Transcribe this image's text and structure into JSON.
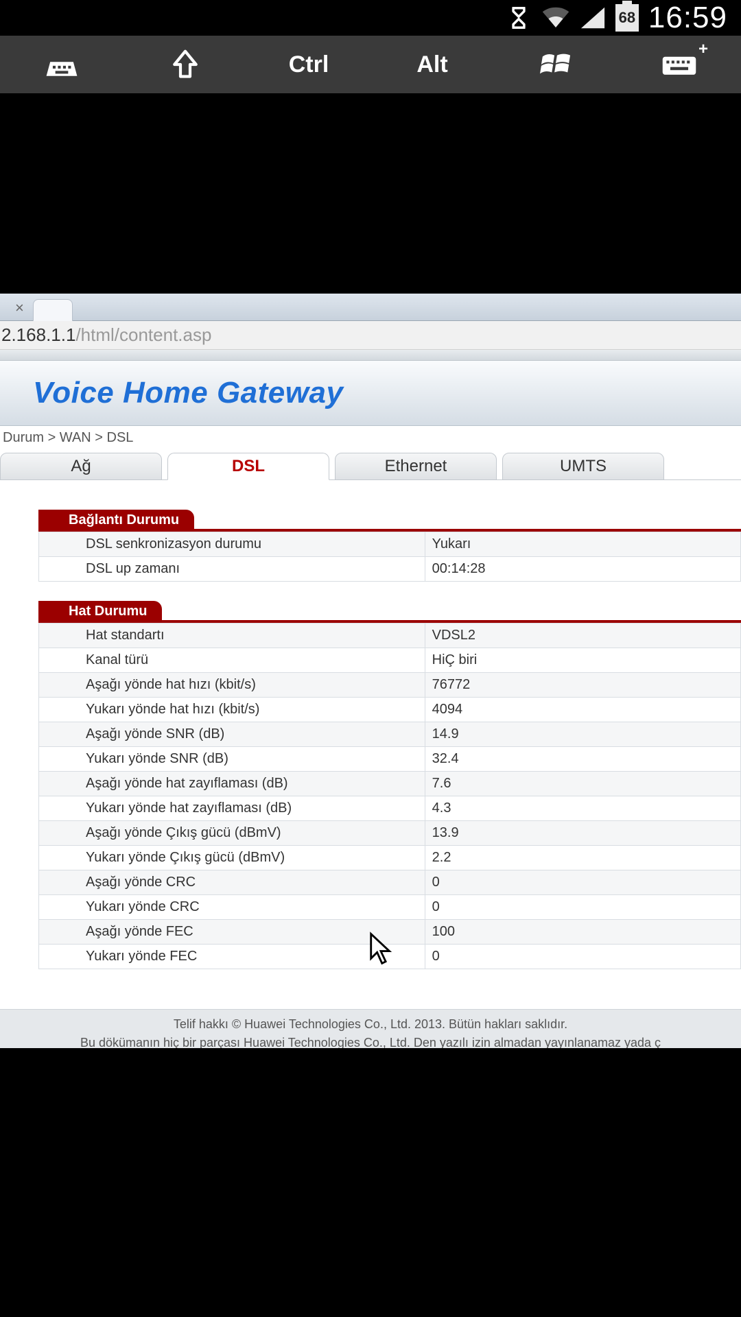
{
  "status_bar": {
    "battery_level": "68",
    "clock": "16:59"
  },
  "rdp_toolbar": {
    "ctrl": "Ctrl",
    "alt": "Alt"
  },
  "browser": {
    "url_host": "2.168.1.1",
    "url_path": "/html/content.asp"
  },
  "page": {
    "title": "Voice Home Gateway",
    "breadcrumb": "Durum > WAN > DSL",
    "tabs": {
      "ag": "Ağ",
      "dsl": "DSL",
      "ethernet": "Ethernet",
      "umts": "UMTS"
    },
    "section1": {
      "title": "Bağlantı Durumu",
      "rows": [
        {
          "label": "DSL senkronizasyon durumu",
          "value": "Yukarı"
        },
        {
          "label": "DSL up zamanı",
          "value": "00:14:28"
        }
      ]
    },
    "section2": {
      "title": "Hat Durumu",
      "rows": [
        {
          "label": "Hat standartı",
          "value": "VDSL2"
        },
        {
          "label": "Kanal türü",
          "value": "HiÇ biri"
        },
        {
          "label": "Aşağı yönde hat hızı (kbit/s)",
          "value": "76772"
        },
        {
          "label": "Yukarı yönde hat hızı (kbit/s)",
          "value": "4094"
        },
        {
          "label": "Aşağı yönde SNR (dB)",
          "value": "14.9"
        },
        {
          "label": "Yukarı yönde SNR (dB)",
          "value": "32.4"
        },
        {
          "label": "Aşağı yönde hat zayıflaması (dB)",
          "value": "7.6"
        },
        {
          "label": "Yukarı yönde hat zayıflaması (dB)",
          "value": "4.3"
        },
        {
          "label": "Aşağı yönde Çıkış gücü (dBmV)",
          "value": "13.9"
        },
        {
          "label": "Yukarı yönde Çıkış gücü (dBmV)",
          "value": "2.2"
        },
        {
          "label": "Aşağı yönde CRC",
          "value": "0"
        },
        {
          "label": "Yukarı yönde CRC",
          "value": "0"
        },
        {
          "label": "Aşağı yönde FEC",
          "value": "100"
        },
        {
          "label": "Yukarı yönde FEC",
          "value": "0"
        }
      ]
    },
    "footer": {
      "line1": "Telif hakkı © Huawei Technologies Co., Ltd. 2013. Bütün hakları saklıdır.",
      "line2": "Bu dökümanın hiç bir parçası Huawei Technologies Co., Ltd. Den yazılı izin almadan yayınlanamaz yada ç"
    }
  }
}
